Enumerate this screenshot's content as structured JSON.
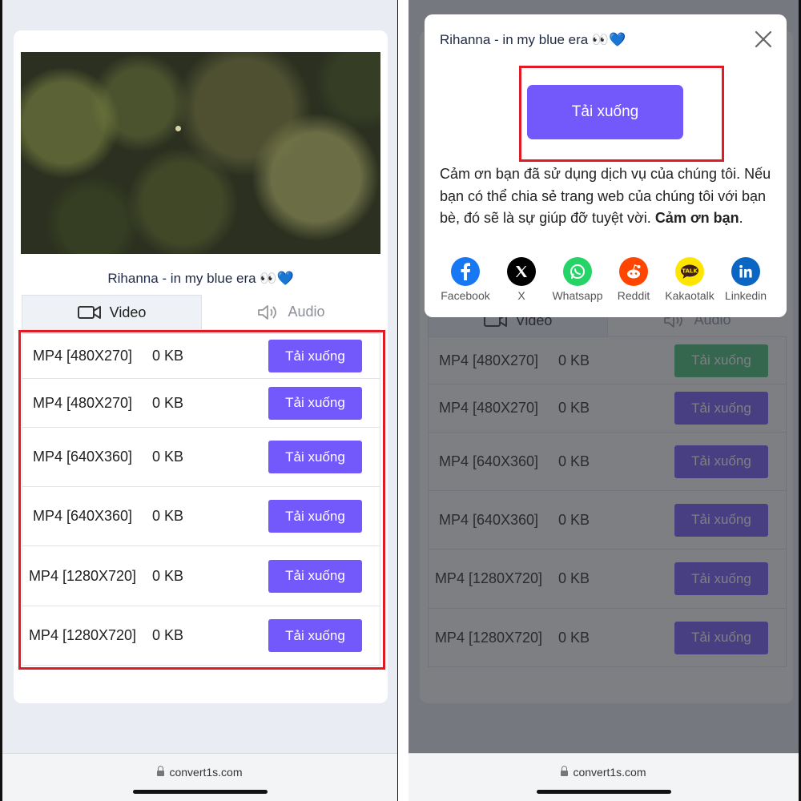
{
  "video_title": "Rihanna - in my blue era 👀💙",
  "tabs": {
    "video": "Video",
    "audio": "Audio"
  },
  "formats": [
    {
      "format": "MP4 [480X270]",
      "size": "0 KB",
      "button": "Tải xuống"
    },
    {
      "format": "MP4 [480X270]",
      "size": "0 KB",
      "button": "Tải xuống"
    },
    {
      "format": "MP4 [640X360]",
      "size": "0 KB",
      "button": "Tải xuống"
    },
    {
      "format": "MP4 [640X360]",
      "size": "0 KB",
      "button": "Tải xuống"
    },
    {
      "format": "MP4 [1280X720]",
      "size": "0 KB",
      "button": "Tải xuống"
    },
    {
      "format": "MP4 [1280X720]",
      "size": "0 KB",
      "button": "Tải xuống"
    }
  ],
  "url": "convert1s.com",
  "modal": {
    "title": "Rihanna - in my blue era 👀💙",
    "download_button": "Tải xuống",
    "message": "Cảm ơn bạn đã sử dụng dịch vụ của chúng tôi. Nếu bạn có thể chia sẻ trang web của chúng tôi với bạn bè, đó sẽ là sự giúp đỡ tuyệt vời.",
    "message_bold": "Cảm ơn bạn",
    "share": [
      {
        "label": "Facebook",
        "icon": "facebook-icon",
        "color": "#1877f2"
      },
      {
        "label": "X",
        "icon": "x-icon",
        "color": "#000000"
      },
      {
        "label": "Whatsapp",
        "icon": "whatsapp-icon",
        "color": "#25d366"
      },
      {
        "label": "Reddit",
        "icon": "reddit-icon",
        "color": "#ff4500"
      },
      {
        "label": "Kakaotalk",
        "icon": "kakaotalk-icon",
        "color": "#fee500"
      },
      {
        "label": "Linkedin",
        "icon": "linkedin-icon",
        "color": "#0a66c2"
      }
    ]
  },
  "colors": {
    "accent": "#7358fb",
    "success": "#3fbf73",
    "highlight": "#e01b24"
  }
}
